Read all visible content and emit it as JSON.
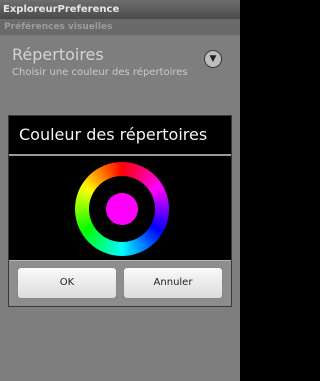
{
  "app": {
    "title": "ExploreurPreference"
  },
  "preferences": {
    "category_label": "Préférences visuelles",
    "item": {
      "title": "Répertoires",
      "summary": "Choisir une couleur des répertoires"
    }
  },
  "dialog": {
    "title": "Couleur des répertoires",
    "selected_color": "#ff00ff",
    "ok_label": "OK",
    "cancel_label": "Annuler"
  }
}
